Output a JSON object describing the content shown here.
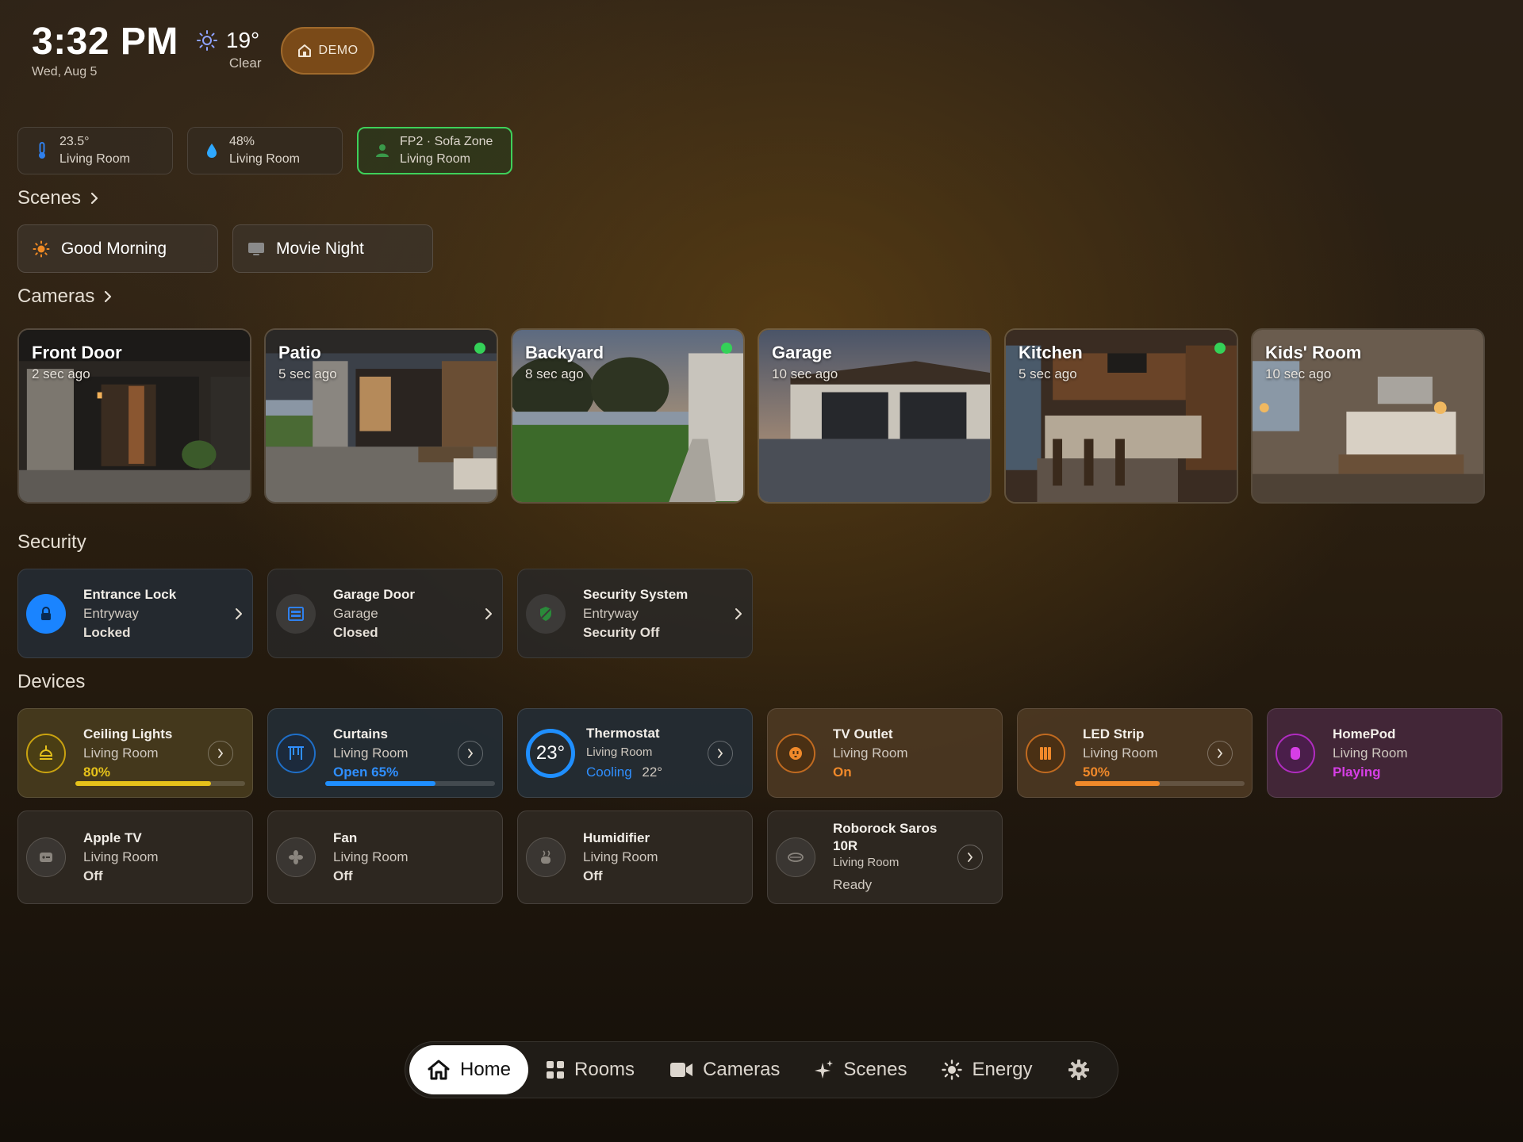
{
  "header": {
    "time": "3:32 PM",
    "date": "Wed, Aug 5",
    "temperature": "19°",
    "condition": "Clear",
    "weather_icon": "sun-icon",
    "demo_label": "DEMO"
  },
  "sensors": [
    {
      "value": "23.5°",
      "room": "Living Room",
      "icon": "thermometer-icon"
    },
    {
      "value": "48%",
      "room": "Living Room",
      "icon": "humidity-icon"
    },
    {
      "value": "FP2 · Sofa Zone",
      "room": "Living Room",
      "icon": "presence-icon",
      "active": true
    }
  ],
  "sections": {
    "scenes": "Scenes",
    "cameras": "Cameras",
    "security": "Security",
    "devices": "Devices"
  },
  "scenes": [
    {
      "label": "Good Morning",
      "icon": "sun-icon"
    },
    {
      "label": "Movie Night",
      "icon": "tv-icon"
    }
  ],
  "cameras": [
    {
      "name": "Front Door",
      "ago": "2 sec ago",
      "live": false
    },
    {
      "name": "Patio",
      "ago": "5 sec ago",
      "live": true
    },
    {
      "name": "Backyard",
      "ago": "8 sec ago",
      "live": true
    },
    {
      "name": "Garage",
      "ago": "10 sec ago",
      "live": false
    },
    {
      "name": "Kitchen",
      "ago": "5 sec ago",
      "live": true
    },
    {
      "name": "Kids' Room",
      "ago": "10 sec ago",
      "live": false
    }
  ],
  "security": [
    {
      "name": "Entrance Lock",
      "room": "Entryway",
      "status": "Locked",
      "icon": "lock-icon"
    },
    {
      "name": "Garage Door",
      "room": "Garage",
      "status": "Closed",
      "icon": "garage-icon"
    },
    {
      "name": "Security System",
      "room": "Entryway",
      "status": "Security Off",
      "icon": "shield-icon"
    }
  ],
  "devices": [
    {
      "name": "Ceiling Lights",
      "room": "Living Room",
      "status": "80%",
      "level": 0.8,
      "color": "#e6c21a",
      "icon": "ceiling-light-icon"
    },
    {
      "name": "Curtains",
      "room": "Living Room",
      "status": "Open 65%",
      "level": 0.65,
      "color": "#1f8fff",
      "icon": "curtains-icon"
    },
    {
      "name": "Thermostat",
      "room": "Living Room",
      "status": "Cooling",
      "target": "22°",
      "current": "23°",
      "color": "#1f8fff",
      "icon": "thermostat-icon"
    },
    {
      "name": "TV Outlet",
      "room": "Living Room",
      "status": "On",
      "color": "#f0892a",
      "icon": "outlet-icon"
    },
    {
      "name": "LED Strip",
      "room": "Living Room",
      "status": "50%",
      "level": 0.5,
      "color": "#f0892a",
      "icon": "led-strip-icon"
    },
    {
      "name": "HomePod",
      "room": "Living Room",
      "status": "Playing",
      "color": "#d63ee6",
      "icon": "homepod-icon"
    },
    {
      "name": "Apple TV",
      "room": "Living Room",
      "status": "Off",
      "icon": "apple-tv-icon"
    },
    {
      "name": "Fan",
      "room": "Living Room",
      "status": "Off",
      "icon": "fan-icon"
    },
    {
      "name": "Humidifier",
      "room": "Living Room",
      "status": "Off",
      "icon": "humidifier-icon"
    },
    {
      "name": "Roborock Saros 10R",
      "room": "Living Room",
      "status": "Ready",
      "icon": "robot-vacuum-icon"
    }
  ],
  "nav": [
    {
      "label": "Home",
      "icon": "home-icon",
      "active": true
    },
    {
      "label": "Rooms",
      "icon": "grid-icon"
    },
    {
      "label": "Cameras",
      "icon": "video-icon"
    },
    {
      "label": "Scenes",
      "icon": "sparkle-icon"
    },
    {
      "label": "Energy",
      "icon": "sun-icon"
    },
    {
      "label": "",
      "icon": "gear-icon"
    }
  ],
  "colors": {
    "accent_blue": "#1f8fff",
    "active_green": "#34d158",
    "demo_brown": "#7a4a18"
  }
}
